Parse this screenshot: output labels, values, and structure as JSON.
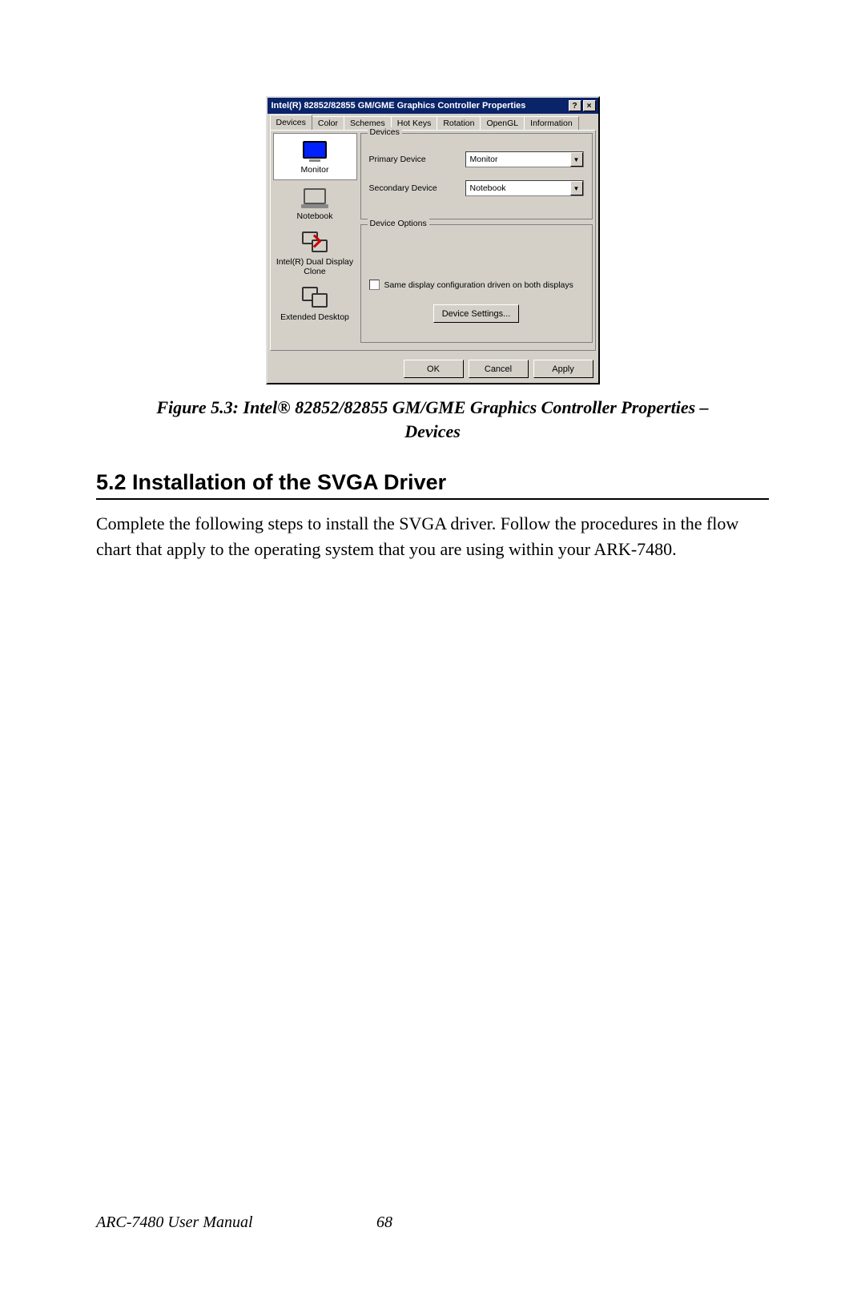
{
  "dialog": {
    "title": "Intel(R) 82852/82855 GM/GME Graphics Controller Properties",
    "helpGlyph": "?",
    "closeGlyph": "×",
    "tabs": [
      "Devices",
      "Color",
      "Schemes",
      "Hot Keys",
      "Rotation",
      "OpenGL",
      "Information"
    ],
    "sidebar": {
      "monitor": "Monitor",
      "notebook": "Notebook",
      "clone": "Intel(R) Dual Display Clone",
      "extended": "Extended Desktop"
    },
    "devicesGroup": {
      "legend": "Devices",
      "primaryLabel": "Primary Device",
      "primaryValue": "Monitor",
      "secondaryLabel": "Secondary Device",
      "secondaryValue": "Notebook"
    },
    "optionsGroup": {
      "legend": "Device Options",
      "checkboxLabel": "Same display configuration driven on both displays",
      "settingsBtn": "Device Settings..."
    },
    "footerButtons": {
      "ok": "OK",
      "cancel": "Cancel",
      "apply": "Apply"
    }
  },
  "caption": "Figure 5.3: Intel® 82852/82855 GM/GME Graphics Controller Properties – Devices",
  "heading": "5.2  Installation of the SVGA Driver",
  "body": "Complete the following steps to install the SVGA driver. Follow the procedures in the flow chart that apply to the operating system that you are using within your ARK-7480.",
  "footer": {
    "manual": "ARC-7480 User Manual",
    "page": "68"
  }
}
